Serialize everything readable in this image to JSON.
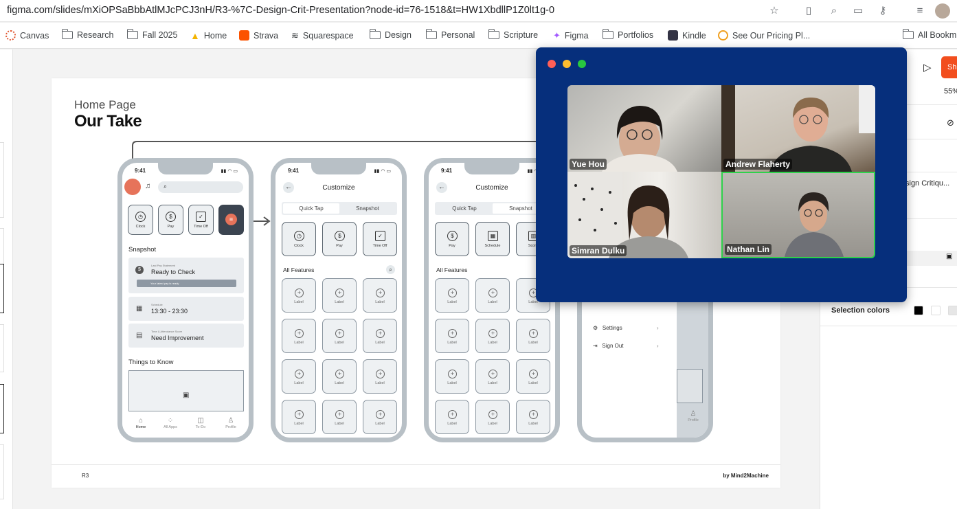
{
  "browser": {
    "url": "figma.com/slides/mXiOPSaBbbAtlMJcPCJ3nH/R3-%7C-Design-Crit-Presentation?node-id=76-1518&t=HW1XbdllP1Z0lt1g-0",
    "bookmarks": [
      "Canvas",
      "Research",
      "Fall 2025",
      "Home",
      "Strava",
      "Squarespace",
      "Design",
      "Personal",
      "Scripture",
      "Figma",
      "Portfolios",
      "Kindle",
      "See Our Pricing Pl...",
      "All Bookm"
    ]
  },
  "slide": {
    "subtitle": "Home Page",
    "title": "Our Take",
    "footer_left": "R3",
    "footer_right": "by Mind2Machine",
    "phone1": {
      "time": "9:41",
      "quick": [
        "Clock",
        "Pay",
        "Time Off"
      ],
      "snapshot": "Snapshot",
      "card1_small": "Last Pay Statement",
      "card1": "Ready to Check",
      "card1_hint": "Your latest pay is ready",
      "card2_small": "Schedule",
      "card2": "13:30 - 23:30",
      "card3_small": "Time & Attendance Score",
      "card3": "Need Improvement",
      "things": "Things to Know",
      "tabs": [
        "Home",
        "All Apps",
        "To-Do",
        "Profile"
      ]
    },
    "phone2": {
      "time": "9:41",
      "title": "Customize",
      "seg": [
        "Quick Tap",
        "Snapshot"
      ],
      "quick": [
        "Clock",
        "Pay",
        "Time Off"
      ],
      "features": "All Features",
      "label": "Label"
    },
    "phone3": {
      "time": "9:41",
      "title": "Customize",
      "seg": [
        "Quick Tap",
        "Snapshot"
      ],
      "quick": [
        "Pay",
        "Schedule",
        "Score"
      ],
      "features": "All Features",
      "label": "Label"
    },
    "phone4": {
      "menu": [
        "Settings",
        "Sign Out"
      ],
      "tab": "Profile"
    }
  },
  "video_call": {
    "participants": [
      "Yue Hou",
      "Andrew Flaherty",
      "Simran Dulku",
      "Nathan Lin"
    ],
    "active_speaker": "Nathan Lin"
  },
  "right_panel": {
    "share": "Sh",
    "zoom": "55%",
    "slide_name": "sign Critiqu...",
    "selection_colors": "Selection colors",
    "colors": [
      "#000000",
      "#ffffff",
      "#e6e6e6"
    ]
  }
}
